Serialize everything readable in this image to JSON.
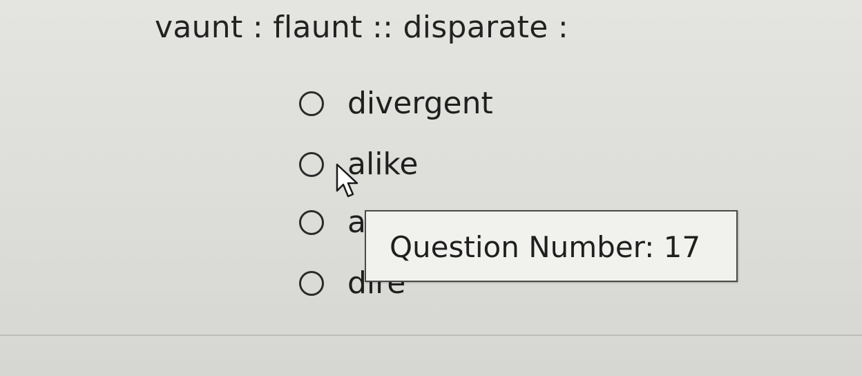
{
  "question": {
    "text": "vaunt : flaunt :: disparate :"
  },
  "options": [
    {
      "label": "divergent"
    },
    {
      "label": "alike"
    },
    {
      "label": "a"
    },
    {
      "label": "dire"
    }
  ],
  "tooltip": {
    "text": "Question Number: 17"
  },
  "cursor": {
    "icon": "mouse-pointer-icon"
  }
}
